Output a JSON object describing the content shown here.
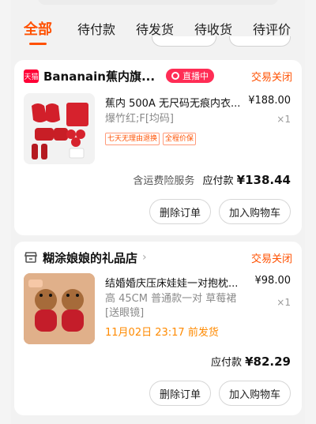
{
  "tabs": [
    {
      "label": "全部"
    },
    {
      "label": "待付款"
    },
    {
      "label": "待发货"
    },
    {
      "label": "待收货"
    },
    {
      "label": "待评价"
    }
  ],
  "orders": [
    {
      "shop_badge": "天猫",
      "shop_name": "Bananain蕉内旗...",
      "live_label": "直播中",
      "status": "交易关闭",
      "title": "蕉内 500A 无尺码无痕内衣...",
      "price": "¥188.00",
      "sku": "爆竹红;F[均码]",
      "qty": "×1",
      "tags": [
        "七天无理由退换",
        "全程价保"
      ],
      "summary_label": "含运费险服务",
      "pay_label": "应付款",
      "amount": "¥138.44",
      "actions": [
        "删除订单",
        "加入购物车"
      ]
    },
    {
      "shop_name": "糊涂娘娘的礼品店",
      "status": "交易关闭",
      "title": "结婚婚庆压床娃娃一对抱枕...",
      "price": "¥98.00",
      "sku_line1": "高 45CM 普通款一对 草莓裙",
      "sku_line2": "[送眼镜]",
      "qty": "×1",
      "ship_info": "11月02日 23:17 前发货",
      "pay_label": "应付款",
      "amount": "¥82.29",
      "actions": [
        "删除订单",
        "加入购物车"
      ]
    }
  ]
}
